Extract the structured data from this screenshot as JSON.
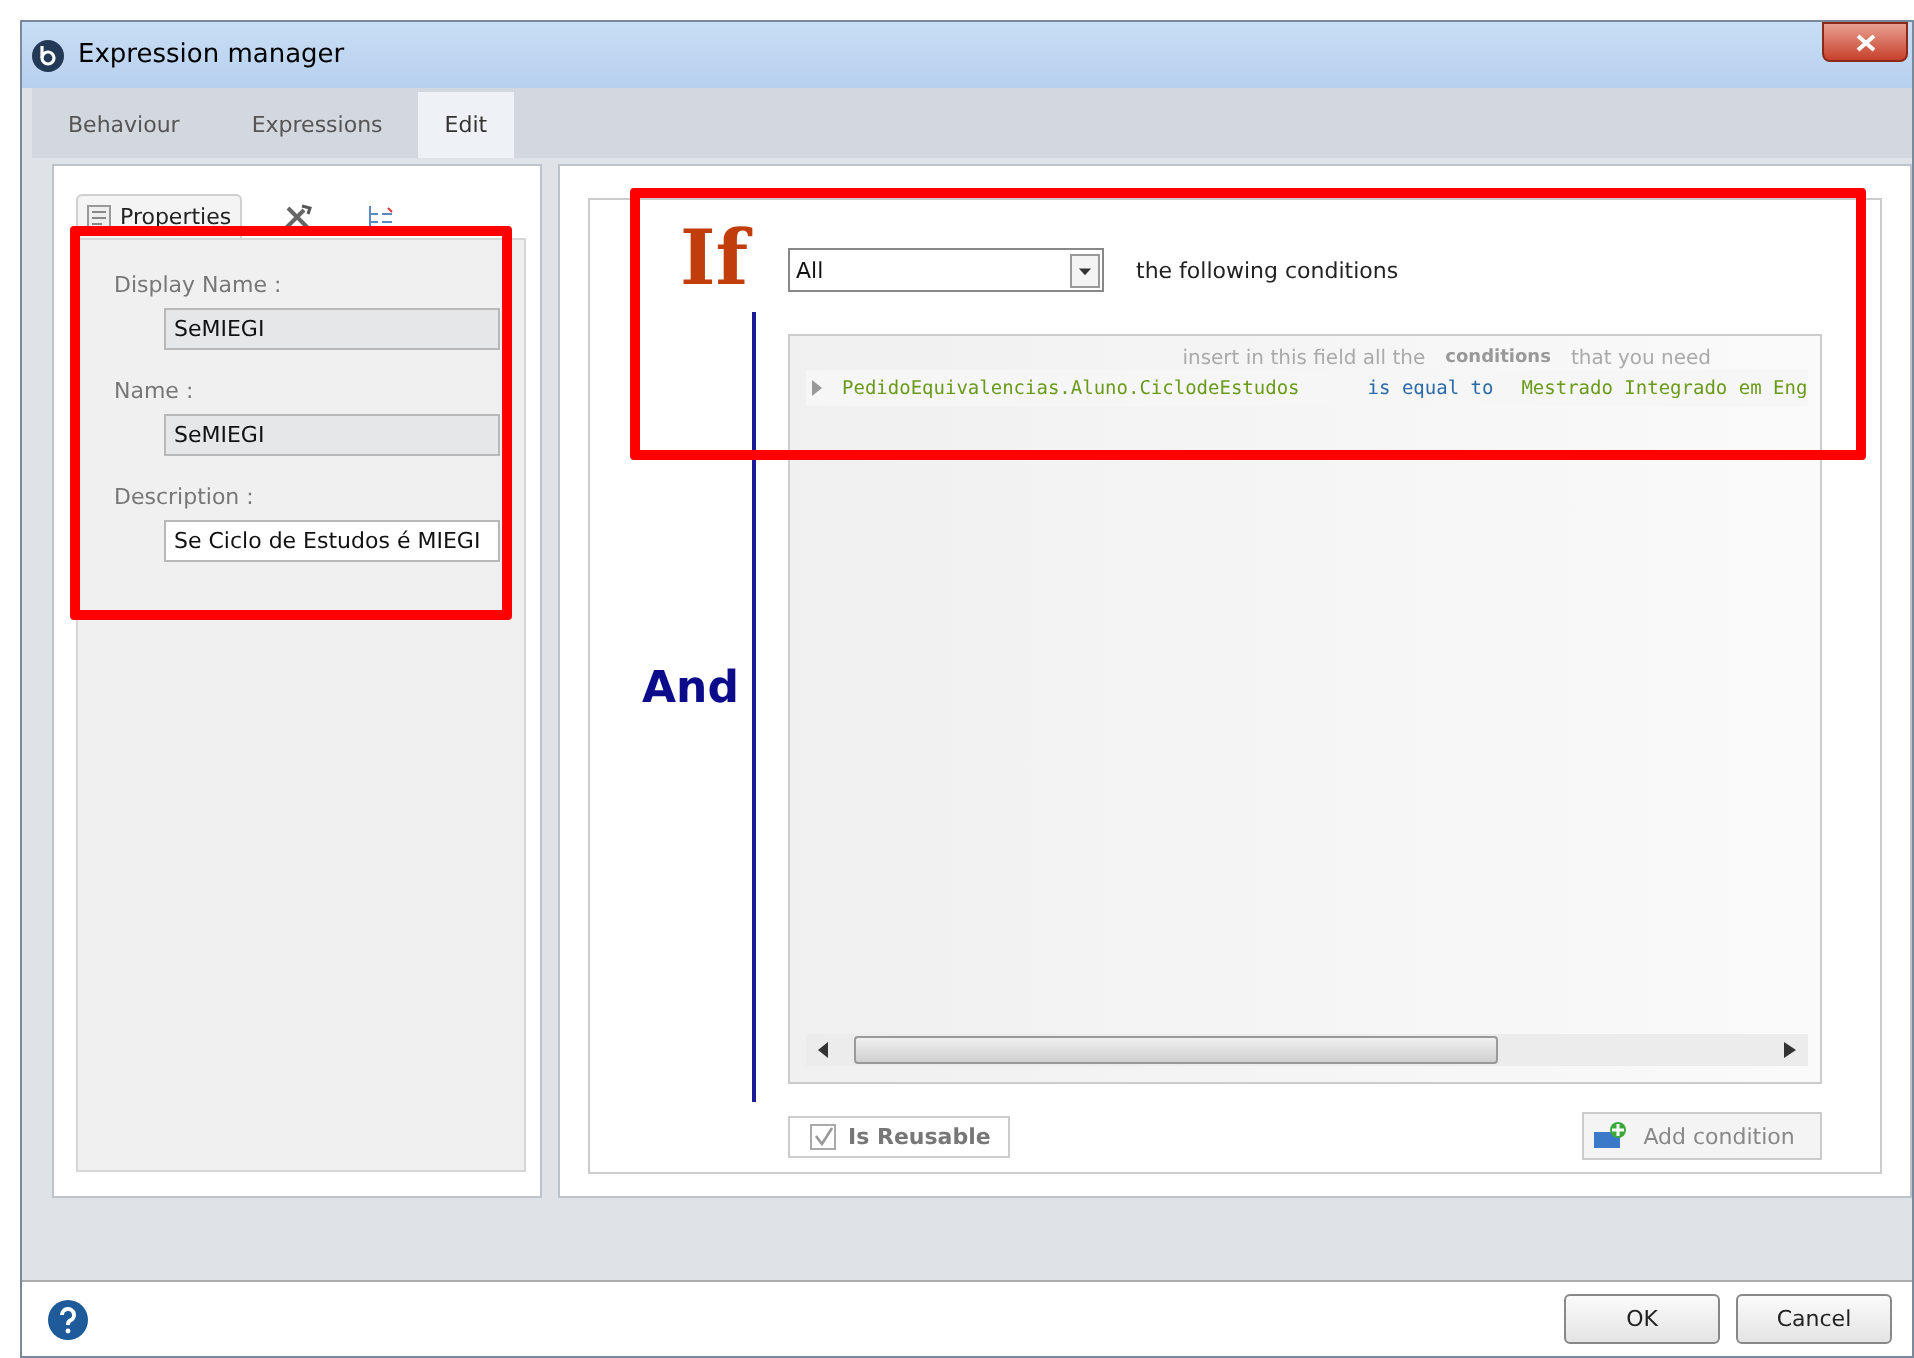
{
  "window": {
    "title": "Expression manager"
  },
  "tabs": [
    {
      "label": "Behaviour",
      "selected": false
    },
    {
      "label": "Expressions",
      "selected": false
    },
    {
      "label": "Edit",
      "selected": true
    }
  ],
  "side_tabs": [
    {
      "kind": "properties",
      "label": "Properties",
      "selected": true
    },
    {
      "kind": "tools",
      "selected": false
    },
    {
      "kind": "tree",
      "selected": false
    }
  ],
  "properties": [
    {
      "label": "Display Name :",
      "value": "SeMIEGI",
      "disabled": true
    },
    {
      "label": "Name :",
      "value": "SeMIEGI",
      "disabled": true
    },
    {
      "label": "Description :",
      "value": "Se Ciclo de Estudos é MIEGI",
      "disabled": false
    }
  ],
  "rule": {
    "if_label": "If",
    "and_label": "And",
    "quantifier": "All",
    "quantifier_suffix": "the following conditions",
    "hint": [
      "insert in this field all the",
      "conditions",
      "that you need"
    ],
    "conditions": [
      {
        "field": "PedidoEquivalencias.Aluno.CiclodeEstudos",
        "operator": "is equal to",
        "value": "Mestrado Integrado em Eng"
      }
    ],
    "reusable": {
      "label": "Is Reusable",
      "checked": true,
      "disabled": true
    },
    "add_button": "Add condition"
  },
  "annotations": [
    {
      "kind": "frame"
    },
    {
      "kind": "frame"
    }
  ],
  "buttons": [
    "OK",
    "Cancel"
  ]
}
